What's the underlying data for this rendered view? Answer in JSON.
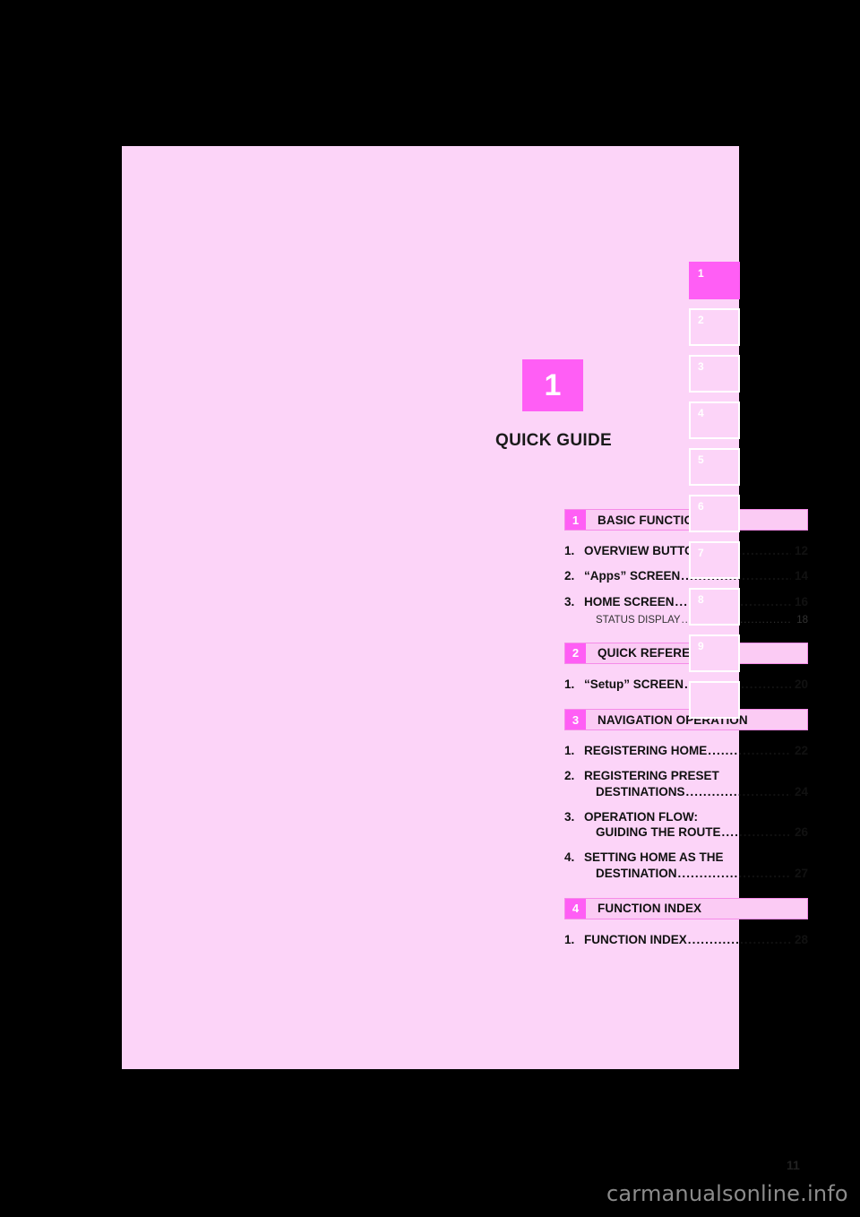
{
  "chapter": {
    "number": "1",
    "title": "QUICK GUIDE"
  },
  "page_number": "11",
  "watermark": "carmanualsonline.info",
  "tabs": [
    {
      "label": "1",
      "active": true
    },
    {
      "label": "2",
      "active": false
    },
    {
      "label": "3",
      "active": false
    },
    {
      "label": "4",
      "active": false
    },
    {
      "label": "5",
      "active": false
    },
    {
      "label": "6",
      "active": false
    },
    {
      "label": "7",
      "active": false
    },
    {
      "label": "8",
      "active": false
    },
    {
      "label": "9",
      "active": false
    },
    {
      "label": "",
      "active": false
    }
  ],
  "leader_dots": "..................................................................................................",
  "toc": [
    {
      "badge": "1",
      "title": "BASIC FUNCTION",
      "entries": [
        {
          "num": "1.",
          "lines": [
            "OVERVIEW BUTTONS"
          ],
          "page": "12"
        },
        {
          "num": "2.",
          "lines": [
            "“Apps” SCREEN"
          ],
          "page": "14"
        },
        {
          "num": "3.",
          "lines": [
            "HOME SCREEN"
          ],
          "page": "16",
          "sub": {
            "text": "STATUS DISPLAY",
            "page": "18"
          }
        }
      ]
    },
    {
      "badge": "2",
      "title": "QUICK REFERENCE",
      "entries": [
        {
          "num": "1.",
          "lines": [
            "“Setup” SCREEN"
          ],
          "page": "20"
        }
      ]
    },
    {
      "badge": "3",
      "title": "NAVIGATION OPERATION",
      "entries": [
        {
          "num": "1.",
          "lines": [
            "REGISTERING HOME"
          ],
          "page": "22"
        },
        {
          "num": "2.",
          "lines": [
            "REGISTERING PRESET",
            "DESTINATIONS"
          ],
          "page": "24"
        },
        {
          "num": "3.",
          "lines": [
            "OPERATION FLOW:",
            "GUIDING THE ROUTE"
          ],
          "page": "26"
        },
        {
          "num": "4.",
          "lines": [
            "SETTING HOME AS THE",
            "DESTINATION"
          ],
          "page": "27"
        }
      ]
    },
    {
      "badge": "4",
      "title": "FUNCTION INDEX",
      "entries": [
        {
          "num": "1.",
          "lines": [
            "FUNCTION INDEX"
          ],
          "page": "28"
        }
      ]
    }
  ]
}
